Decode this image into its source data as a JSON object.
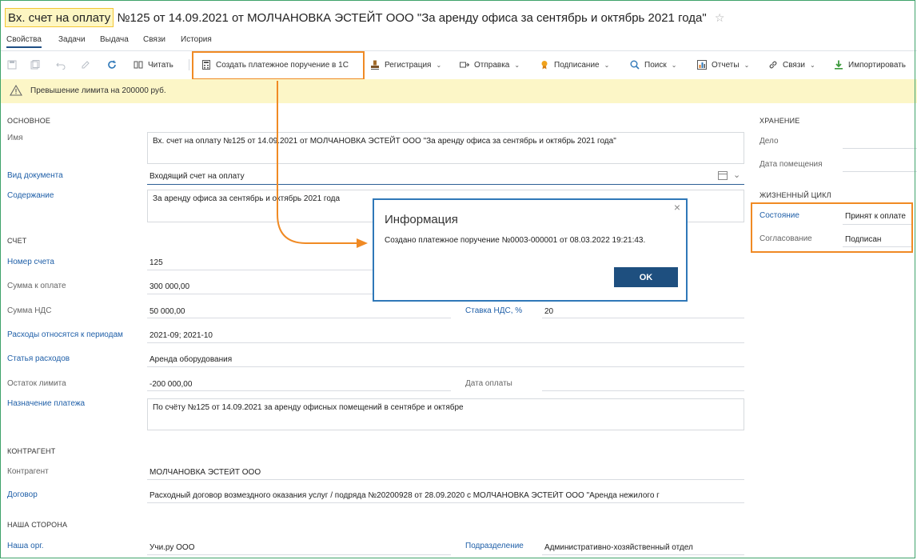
{
  "title": {
    "prefix": "Вх. счет на оплату",
    "rest": "№125 от 14.09.2021 от МОЛЧАНОВКА ЭСТЕЙТ ООО \"За аренду офиса за сентябрь и октябрь 2021 года\""
  },
  "tabs": [
    "Свойства",
    "Задачи",
    "Выдача",
    "Связи",
    "История"
  ],
  "toolbar": {
    "read": "Читать",
    "create_payment": "Создать платежное поручение в 1С",
    "registration": "Регистрация",
    "send": "Отправка",
    "sign": "Подписание",
    "search": "Поиск",
    "reports": "Отчеты",
    "links": "Связи",
    "import": "Импортировать"
  },
  "warning": "Превышение лимита на 200000 руб.",
  "main": {
    "section_basic": "ОСНОВНОЕ",
    "name_label": "Имя",
    "name_value": "Вх. счет на оплату №125 от 14.09.2021 от МОЛЧАНОВКА ЭСТЕЙТ ООО \"За аренду офиса за сентябрь и октябрь 2021 года\"",
    "doc_type_label": "Вид документа",
    "doc_type_value": "Входящий счет на оплату",
    "content_label": "Содержание",
    "content_value": "За аренду офиса за сентябрь и октябрь 2021 года",
    "section_invoice": "СЧЕТ",
    "invoice_number_label": "Номер счета",
    "invoice_number_value": "125",
    "amount_label": "Сумма к оплате",
    "amount_value": "300 000,00",
    "vat_label": "Сумма НДС",
    "vat_value": "50 000,00",
    "vat_rate_label": "Ставка НДС, %",
    "vat_rate_value": "20",
    "periods_label": "Расходы относятся к периодам",
    "periods_value": "2021-09; 2021-10",
    "expense_label": "Статья расходов",
    "expense_value": "Аренда оборудования",
    "limit_label": "Остаток лимита",
    "limit_value": "-200 000,00",
    "pay_date_label": "Дата оплаты",
    "purpose_label": "Назначение платежа",
    "purpose_value": "По счёту №125 от 14.09.2021 за аренду офисных помещений в сентябре и октябре",
    "section_counterparty": "КОНТРАГЕНТ",
    "counterparty_label": "Контрагент",
    "counterparty_value": "МОЛЧАНОВКА ЭСТЕЙТ ООО",
    "contract_label": "Договор",
    "contract_value": "Расходный договор возмездного оказания услуг / подряда №20200928 от 28.09.2020 с МОЛЧАНОВКА ЭСТЕЙТ ООО \"Аренда нежилого г",
    "section_our": "НАША СТОРОНА",
    "our_org_label": "Наша орг.",
    "our_org_value": "Учи.ру ООО",
    "department_label": "Подразделение",
    "department_value": "Административно-хозяйственный отдел"
  },
  "right": {
    "section_storage": "ХРАНЕНИЕ",
    "case_label": "Дело",
    "date_placed_label": "Дата помещения",
    "section_lifecycle": "ЖИЗНЕННЫЙ ЦИКЛ",
    "state_label": "Состояние",
    "state_value": "Принят к оплате",
    "approval_label": "Согласование",
    "approval_value": "Подписан"
  },
  "dialog": {
    "title": "Информация",
    "message": "Создано платежное поручение №0003-000001 от 08.03.2022 19:21:43.",
    "ok": "OK"
  },
  "colors": {
    "accent": "#1e4f7f",
    "highlight": "#f08a24",
    "warning_bg": "#fcf6c7",
    "link": "#1f5fa8"
  }
}
